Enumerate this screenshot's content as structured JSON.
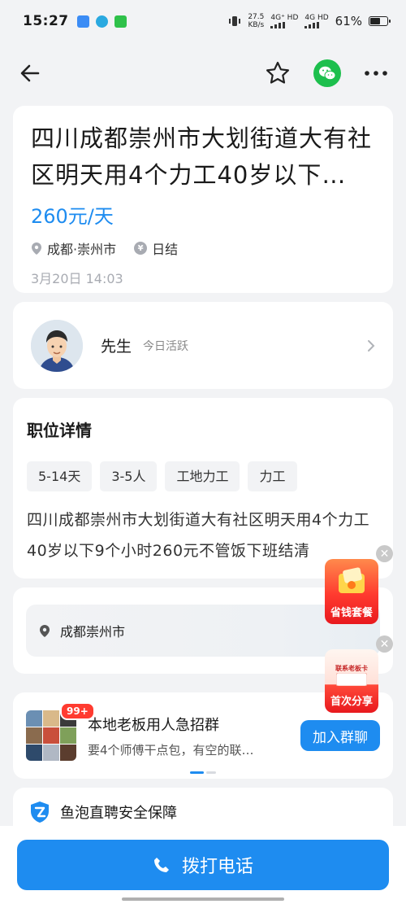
{
  "status_bar": {
    "time": "15:27",
    "net_speed_value": "27.5",
    "net_speed_unit": "KB/s",
    "sim1": "4G⁺ HD",
    "sim2": "4G HD",
    "battery_pct": "61%",
    "battery_level": 0.61
  },
  "nav": {
    "back_icon": "arrow-left-icon",
    "favorite_icon": "star-outline-icon",
    "share_icon": "wechat-icon",
    "more_icon": "more-horizontal-icon"
  },
  "job": {
    "title": "四川成都崇州市大划街道大有社区明天用4个力工40岁以下…",
    "salary": "260元/天",
    "location": "成都·崇州市",
    "settlement": "日结",
    "posted_at": "3月20日 14:03"
  },
  "boss": {
    "name": "先生",
    "active_status": "今日活跃"
  },
  "detail": {
    "section_title": "职位详情",
    "tags": [
      "5-14天",
      "3-5人",
      "工地力工",
      "力工"
    ],
    "description": "四川成都崇州市大划街道大有社区明天用4个力工40岁以下9个小时260元不管饭下班结清"
  },
  "location_card": {
    "address": "成都崇州市"
  },
  "group": {
    "badge": "99+",
    "title": "本地老板用人急招群",
    "subtitle": "要4个师傅干点包，有空的联…",
    "join_label": "加入群聊"
  },
  "safety": {
    "title": "鱼泡直聘安全保障"
  },
  "floating_ads": {
    "ad1_label": "省钱套餐",
    "ad2_top": "联系老板卡",
    "ad2_label": "首次分享"
  },
  "bottom": {
    "call_label": "拨打电话"
  },
  "colors": {
    "accent": "#1e8cf0",
    "wechat": "#1dbf4d",
    "background": "#f2f3f5"
  }
}
